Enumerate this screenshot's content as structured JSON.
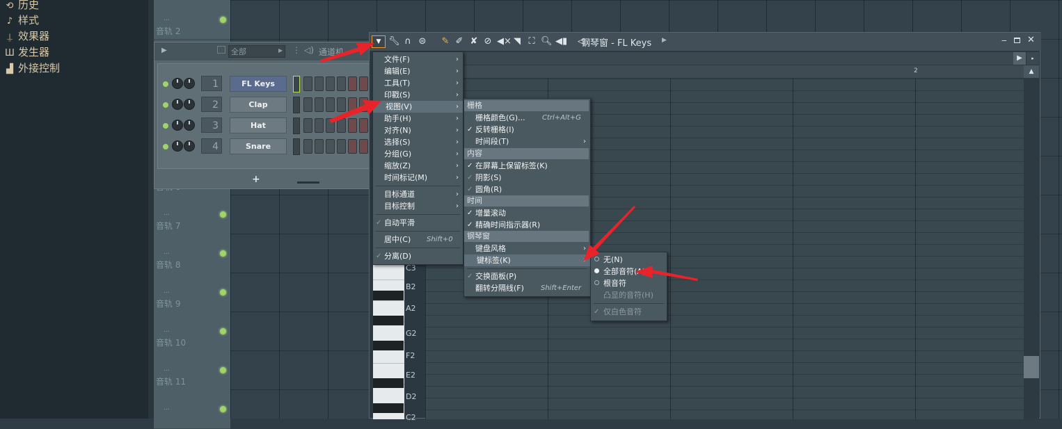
{
  "browser": {
    "items": [
      {
        "label": "历史",
        "icon": "history-icon"
      },
      {
        "label": "样式",
        "icon": "note-icon"
      },
      {
        "label": "效果器",
        "icon": "plug-icon"
      },
      {
        "label": "发生器",
        "icon": "piano-icon"
      },
      {
        "label": "外接控制",
        "icon": "controller-icon"
      }
    ]
  },
  "playlist": {
    "tracks": [
      "音轨 2",
      "音轨 6",
      "音轨 7",
      "音轨 8",
      "音轨 9",
      "音轨 10",
      "音轨 11"
    ],
    "track_dots": "..."
  },
  "channel_rack": {
    "filter": "全部",
    "title": "通道机",
    "add_label": "+",
    "channels": [
      {
        "num": "1",
        "name": "FL Keys"
      },
      {
        "num": "2",
        "name": "Clap"
      },
      {
        "num": "3",
        "name": "Hat"
      },
      {
        "num": "4",
        "name": "Snare"
      }
    ]
  },
  "piano_roll": {
    "title": "钢琴窗 - FL Keys",
    "ruler_bar": "2",
    "keys": [
      "C3",
      "B2",
      "A2",
      "G2",
      "F2",
      "E2",
      "D2",
      "C2"
    ]
  },
  "main_menu": {
    "items": [
      {
        "label": "文件(F)"
      },
      {
        "label": "编辑(E)"
      },
      {
        "label": "工具(T)"
      },
      {
        "label": "印戳(S)"
      },
      {
        "label": "视图(V)"
      },
      {
        "label": "助手(H)"
      },
      {
        "label": "对齐(N)"
      },
      {
        "label": "选择(S)"
      },
      {
        "label": "分组(G)"
      },
      {
        "label": "缩放(Z)"
      },
      {
        "label": "时间标记(M)"
      },
      {
        "label": "目标通道"
      },
      {
        "label": "目标控制"
      },
      {
        "label": "自动平滑"
      },
      {
        "label": "居中(C)",
        "shortcut": "Shift+0"
      },
      {
        "label": "分离(D)"
      }
    ]
  },
  "view_menu": {
    "headers": [
      "栅格",
      "内容",
      "时间",
      "钢琴窗"
    ],
    "items": [
      {
        "label": "栅格颜色(G)...",
        "shortcut": "Ctrl+Alt+G"
      },
      {
        "label": "反转栅格(I)"
      },
      {
        "label": "时间段(T)"
      },
      {
        "label": "在屏幕上保留标签(K)"
      },
      {
        "label": "阴影(S)"
      },
      {
        "label": "圆角(R)"
      },
      {
        "label": "增量滚动"
      },
      {
        "label": "精确时间指示器(R)"
      },
      {
        "label": "键盘风格"
      },
      {
        "label": "键标签(K)"
      },
      {
        "label": "交换面板(P)"
      },
      {
        "label": "翻转分隔线(F)",
        "shortcut": "Shift+Enter"
      }
    ]
  },
  "key_label_menu": {
    "items": [
      {
        "label": "无(N)"
      },
      {
        "label": "全部音符(A)"
      },
      {
        "label": "根音符"
      },
      {
        "label": "凸显的音符(H)"
      },
      {
        "label": "仅白色音符"
      }
    ]
  },
  "colors": {
    "accent": "#f39a2a",
    "arrow": "#e8232a",
    "led": "#9ed46a"
  }
}
